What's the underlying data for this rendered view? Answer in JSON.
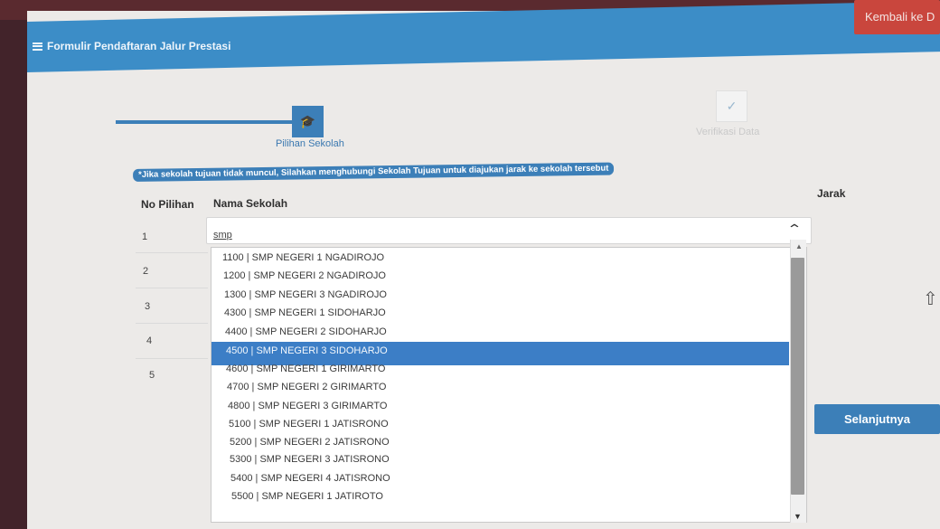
{
  "header": {
    "title": "Formulir Pendaftaran Jalur Prestasi",
    "back_button": "Kembali ke D"
  },
  "steps": [
    {
      "label": "Pilihan Sekolah",
      "icon": "graduation-cap-icon",
      "active": true
    },
    {
      "label": "Verifikasi Data",
      "icon": "check-icon",
      "active": false
    }
  ],
  "notice": "*Jika sekolah tujuan tidak muncul, Silahkan menghubungi Sekolah Tujuan untuk diajukan jarak ke sekolah tersebut",
  "table": {
    "col_no": "No Pilihan",
    "col_name": "Nama Sekolah",
    "col_distance": "Jarak",
    "rows": [
      "1",
      "2",
      "3",
      "4",
      "5"
    ]
  },
  "select": {
    "value": "smp"
  },
  "dropdown": {
    "options": [
      "1100 | SMP NEGERI 1 NGADIROJO",
      "1200 | SMP NEGERI 2 NGADIROJO",
      "1300 | SMP NEGERI 3 NGADIROJO",
      "4300 | SMP NEGERI 1 SIDOHARJO",
      "4400 | SMP NEGERI 2 SIDOHARJO",
      "4500 | SMP NEGERI 3 SIDOHARJO",
      "4600 | SMP NEGERI 1 GIRIMARTO",
      "4700 | SMP NEGERI 2 GIRIMARTO",
      "4800 | SMP NEGERI 3 GIRIMARTO",
      "5100 | SMP NEGERI 1 JATISRONO",
      "5200 | SMP NEGERI 2 JATISRONO",
      "5300 | SMP NEGERI 3 JATISRONO",
      "5400 | SMP NEGERI 4 JATISRONO",
      "5500 | SMP NEGERI 1 JATIROTO"
    ],
    "selected_index": 5
  },
  "next_button": "Selanjutnya",
  "colors": {
    "primary": "#3c7fb8",
    "danger": "#c9463d",
    "selected_option": "#3c7ec6"
  }
}
